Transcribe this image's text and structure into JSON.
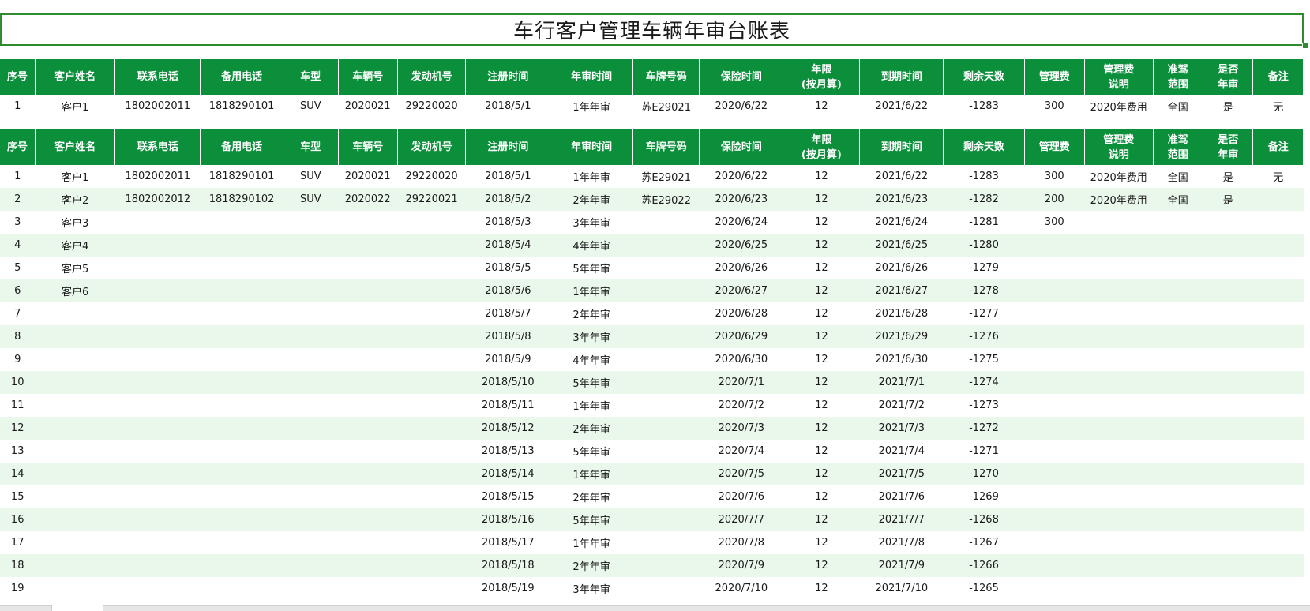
{
  "title": "车行客户管理车辆年审台账表",
  "headers": [
    "序号",
    "客户姓名",
    "联系电话",
    "备用电话",
    "车型",
    "车辆号",
    "发动机号",
    "注册时间",
    "年审时间",
    "车牌号码",
    "保险时间",
    "年限\n(按月算)",
    "到期时间",
    "剩余天数",
    "管理费",
    "管理费\n说明",
    "准驾\n范围",
    "是否\n年审",
    "备注"
  ],
  "summary_rows": [
    [
      "1",
      "客户1",
      "1802002011",
      "1818290101",
      "SUV",
      "2020021",
      "29220020",
      "2018/5/1",
      "1年年审",
      "苏E29021",
      "2020/6/22",
      "12",
      "2021/6/22",
      "-1283",
      "300",
      "2020年费用",
      "全国",
      "是",
      "无"
    ]
  ],
  "rows": [
    [
      "1",
      "客户1",
      "1802002011",
      "1818290101",
      "SUV",
      "2020021",
      "29220020",
      "2018/5/1",
      "1年年审",
      "苏E29021",
      "2020/6/22",
      "12",
      "2021/6/22",
      "-1283",
      "300",
      "2020年费用",
      "全国",
      "是",
      "无"
    ],
    [
      "2",
      "客户2",
      "1802002012",
      "1818290102",
      "SUV",
      "2020022",
      "29220021",
      "2018/5/2",
      "2年年审",
      "苏E29022",
      "2020/6/23",
      "12",
      "2021/6/23",
      "-1282",
      "200",
      "2020年费用",
      "全国",
      "是",
      ""
    ],
    [
      "3",
      "客户3",
      "",
      "",
      "",
      "",
      "",
      "2018/5/3",
      "3年年审",
      "",
      "2020/6/24",
      "12",
      "2021/6/24",
      "-1281",
      "300",
      "",
      "",
      "",
      ""
    ],
    [
      "4",
      "客户4",
      "",
      "",
      "",
      "",
      "",
      "2018/5/4",
      "4年年审",
      "",
      "2020/6/25",
      "12",
      "2021/6/25",
      "-1280",
      "",
      "",
      "",
      "",
      ""
    ],
    [
      "5",
      "客户5",
      "",
      "",
      "",
      "",
      "",
      "2018/5/5",
      "5年年审",
      "",
      "2020/6/26",
      "12",
      "2021/6/26",
      "-1279",
      "",
      "",
      "",
      "",
      ""
    ],
    [
      "6",
      "客户6",
      "",
      "",
      "",
      "",
      "",
      "2018/5/6",
      "1年年审",
      "",
      "2020/6/27",
      "12",
      "2021/6/27",
      "-1278",
      "",
      "",
      "",
      "",
      ""
    ],
    [
      "7",
      "",
      "",
      "",
      "",
      "",
      "",
      "2018/5/7",
      "2年年审",
      "",
      "2020/6/28",
      "12",
      "2021/6/28",
      "-1277",
      "",
      "",
      "",
      "",
      ""
    ],
    [
      "8",
      "",
      "",
      "",
      "",
      "",
      "",
      "2018/5/8",
      "3年年审",
      "",
      "2020/6/29",
      "12",
      "2021/6/29",
      "-1276",
      "",
      "",
      "",
      "",
      ""
    ],
    [
      "9",
      "",
      "",
      "",
      "",
      "",
      "",
      "2018/5/9",
      "4年年审",
      "",
      "2020/6/30",
      "12",
      "2021/6/30",
      "-1275",
      "",
      "",
      "",
      "",
      ""
    ],
    [
      "10",
      "",
      "",
      "",
      "",
      "",
      "",
      "2018/5/10",
      "5年年审",
      "",
      "2020/7/1",
      "12",
      "2021/7/1",
      "-1274",
      "",
      "",
      "",
      "",
      ""
    ],
    [
      "11",
      "",
      "",
      "",
      "",
      "",
      "",
      "2018/5/11",
      "1年年审",
      "",
      "2020/7/2",
      "12",
      "2021/7/2",
      "-1273",
      "",
      "",
      "",
      "",
      ""
    ],
    [
      "12",
      "",
      "",
      "",
      "",
      "",
      "",
      "2018/5/12",
      "2年年审",
      "",
      "2020/7/3",
      "12",
      "2021/7/3",
      "-1272",
      "",
      "",
      "",
      "",
      ""
    ],
    [
      "13",
      "",
      "",
      "",
      "",
      "",
      "",
      "2018/5/13",
      "5年年审",
      "",
      "2020/7/4",
      "12",
      "2021/7/4",
      "-1271",
      "",
      "",
      "",
      "",
      ""
    ],
    [
      "14",
      "",
      "",
      "",
      "",
      "",
      "",
      "2018/5/14",
      "1年年审",
      "",
      "2020/7/5",
      "12",
      "2021/7/5",
      "-1270",
      "",
      "",
      "",
      "",
      ""
    ],
    [
      "15",
      "",
      "",
      "",
      "",
      "",
      "",
      "2018/5/15",
      "2年年审",
      "",
      "2020/7/6",
      "12",
      "2021/7/6",
      "-1269",
      "",
      "",
      "",
      "",
      ""
    ],
    [
      "16",
      "",
      "",
      "",
      "",
      "",
      "",
      "2018/5/16",
      "5年年审",
      "",
      "2020/7/7",
      "12",
      "2021/7/7",
      "-1268",
      "",
      "",
      "",
      "",
      ""
    ],
    [
      "17",
      "",
      "",
      "",
      "",
      "",
      "",
      "2018/5/17",
      "1年年审",
      "",
      "2020/7/8",
      "12",
      "2021/7/8",
      "-1267",
      "",
      "",
      "",
      "",
      ""
    ],
    [
      "18",
      "",
      "",
      "",
      "",
      "",
      "",
      "2018/5/18",
      "2年年审",
      "",
      "2020/7/9",
      "12",
      "2021/7/9",
      "-1266",
      "",
      "",
      "",
      "",
      ""
    ],
    [
      "19",
      "",
      "",
      "",
      "",
      "",
      "",
      "2018/5/19",
      "3年年审",
      "",
      "2020/7/10",
      "12",
      "2021/7/10",
      "-1265",
      "",
      "",
      "",
      "",
      ""
    ]
  ],
  "colors": {
    "header_bg": "#0b8f3a",
    "band": "#eaf8ec",
    "title_border": "#2e8b2e"
  }
}
